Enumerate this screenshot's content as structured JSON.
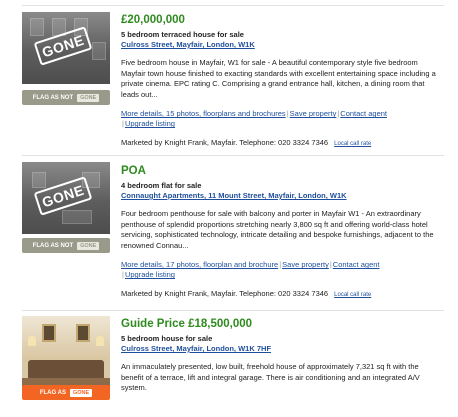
{
  "listings": [
    {
      "price": "£20,000,000",
      "type": "5 bedroom terraced house for sale",
      "address": "Culross Street, Mayfair, London, W1K",
      "description": "Five bedroom house in Mayfair, W1 for sale - A beautiful contemporary style five bedroom Mayfair town house finished to exacting standards with excellent entertaining space including a private cinema. EPC rating C. Comprising a grand entrance hall, kitchen, a dining room that leads out...",
      "photo_badge": "GONE",
      "flag_label": "FLAG AS NOT",
      "flag_tag": "GONE",
      "links": {
        "details": "More details, 15 photos, floorplans and brochures",
        "save": "Save property",
        "contact": "Contact agent",
        "upgrade": "Upgrade listing"
      },
      "marketed_by": "Marketed by Knight Frank, Mayfair. Telephone: 020 3324 7346",
      "local_call": "Local call rate"
    },
    {
      "price": "POA",
      "type": "4 bedroom flat for sale",
      "address": "Connaught Apartments, 11 Mount Street, Mayfair, London, W1K",
      "description": "Four bedroom penthouse for sale with balcony and porter in Mayfair W1 - An extraordinary penthouse of splendid proportions stretching nearly 3,800 sq ft and offering world-class hotel servicing, sophisticated technology, intricate detailing and bespoke furnishings, adjacent to the renowned Connau...",
      "photo_badge": "GONE",
      "flag_label": "FLAG AS NOT",
      "flag_tag": "GONE",
      "links": {
        "details": "More details, 17 photos, floorplan and brochure",
        "save": "Save property",
        "contact": "Contact agent",
        "upgrade": "Upgrade listing"
      },
      "marketed_by": "Marketed by Knight Frank, Mayfair. Telephone: 020 3324 7346",
      "local_call": "Local call rate"
    },
    {
      "price": "Guide Price £18,500,000",
      "type": "5 bedroom house for sale",
      "address": "Culross Street, Mayfair, London, W1K 7HF",
      "description": "An immaculately presented, low built, freehold house of approximately 7,321 sq ft with the benefit of a terrace, lift and integral garage. There is air conditioning and an integrated A/V system.",
      "flag_label": "FLAG AS",
      "flag_tag": "GONE"
    }
  ],
  "colors": {
    "price_green": "#2e8b1e",
    "link_blue": "#1f4f9c",
    "flag_grey": "#9a9a8a",
    "flag_orange": "#f26522"
  }
}
